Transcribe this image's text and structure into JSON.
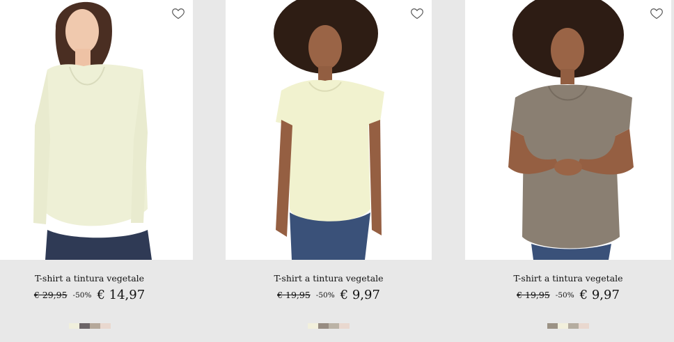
{
  "products": [
    {
      "name": "T-shirt a tintura vegetale",
      "old_price": "€ 29,95",
      "discount": "-50%",
      "price": "€ 14,97",
      "shirt_color": "#eef0d6",
      "swatches": [
        "#f0efdc",
        "#6b6467",
        "#b5a89a",
        "#e9d8cf"
      ]
    },
    {
      "name": "T-shirt a tintura vegetale",
      "old_price": "€ 19,95",
      "discount": "-50%",
      "price": "€ 9,97",
      "shirt_color": "#f1f2cf",
      "swatches": [
        "#f2f0dc",
        "#978c82",
        "#bbb3a6",
        "#e9d8cf"
      ]
    },
    {
      "name": "T-shirt a tintura vegetale",
      "old_price": "€ 19,95",
      "discount": "-50%",
      "price": "€ 9,97",
      "shirt_color": "#8a7f72",
      "swatches": [
        "#9b9285",
        "#f2f0dc",
        "#b5ada0",
        "#e9d8cf"
      ]
    }
  ]
}
